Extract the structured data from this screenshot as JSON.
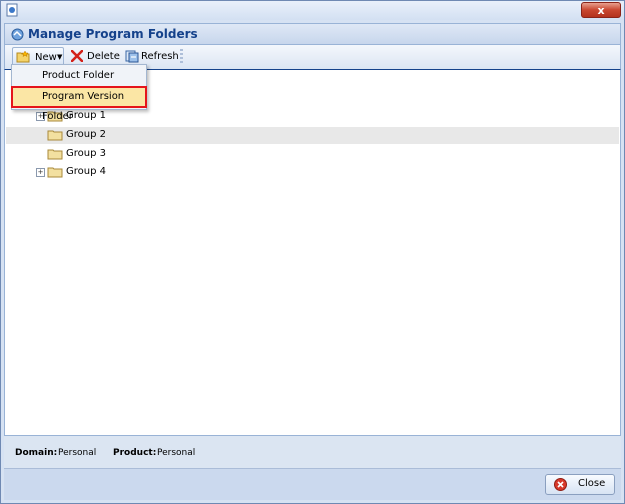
{
  "window": {
    "title": "Manage Program Folders",
    "close_glyph": "x"
  },
  "toolbar": {
    "new_label": "New",
    "delete_label": "Delete",
    "refresh_label": "Refresh"
  },
  "new_menu": {
    "items": [
      {
        "label": "Product Folder",
        "highlighted": false
      },
      {
        "label": "Program Version Folder",
        "highlighted": true
      }
    ]
  },
  "tree": {
    "items": [
      {
        "label": "Group 1",
        "expandable": true,
        "selected": false
      },
      {
        "label": "Group 2",
        "expandable": false,
        "selected": true
      },
      {
        "label": "Group 3",
        "expandable": false,
        "selected": false
      },
      {
        "label": "Group 4",
        "expandable": true,
        "selected": false
      }
    ]
  },
  "status": {
    "domain_key": "Domain:",
    "domain_value": "Personal",
    "product_key": "Product:",
    "product_value": "Personal"
  },
  "footer": {
    "close_label": "Close"
  },
  "colors": {
    "header_text": "#15428b",
    "highlight_bg": "#fbe6a5",
    "highlight_outline": "#e5141b",
    "selected_row": "#e8e8e8"
  },
  "icons": [
    "app-icon",
    "manage-folders-icon",
    "new-folder-icon",
    "delete-icon",
    "refresh-icon",
    "folder-icon",
    "expand-icon",
    "close-icon"
  ]
}
